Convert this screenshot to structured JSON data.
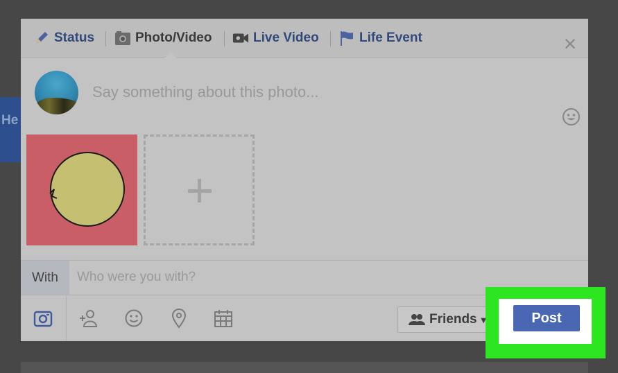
{
  "background": {
    "side_text": "He ma"
  },
  "tabs": [
    {
      "label": "Status",
      "icon": "pencil-icon",
      "active": false
    },
    {
      "label": "Photo/Video",
      "icon": "camera-icon",
      "active": true
    },
    {
      "label": "Live Video",
      "icon": "video-camera-icon",
      "active": false
    },
    {
      "label": "Life Event",
      "icon": "flag-icon",
      "active": false
    }
  ],
  "close_icon": "×",
  "composer": {
    "placeholder": "Say something about this photo..."
  },
  "with_row": {
    "label": "With",
    "placeholder": "Who were you with?"
  },
  "bottom_bar": {
    "icons": [
      "photo-icon",
      "tag-friends-icon",
      "feeling-icon",
      "location-icon",
      "event-icon"
    ]
  },
  "audience": {
    "label": "Friends",
    "arrow": "▾"
  },
  "post_button": {
    "label": "Post"
  },
  "colors": {
    "accent": "#4a67b3",
    "highlight": "#2ce61f",
    "tab_text": "#31497a"
  }
}
